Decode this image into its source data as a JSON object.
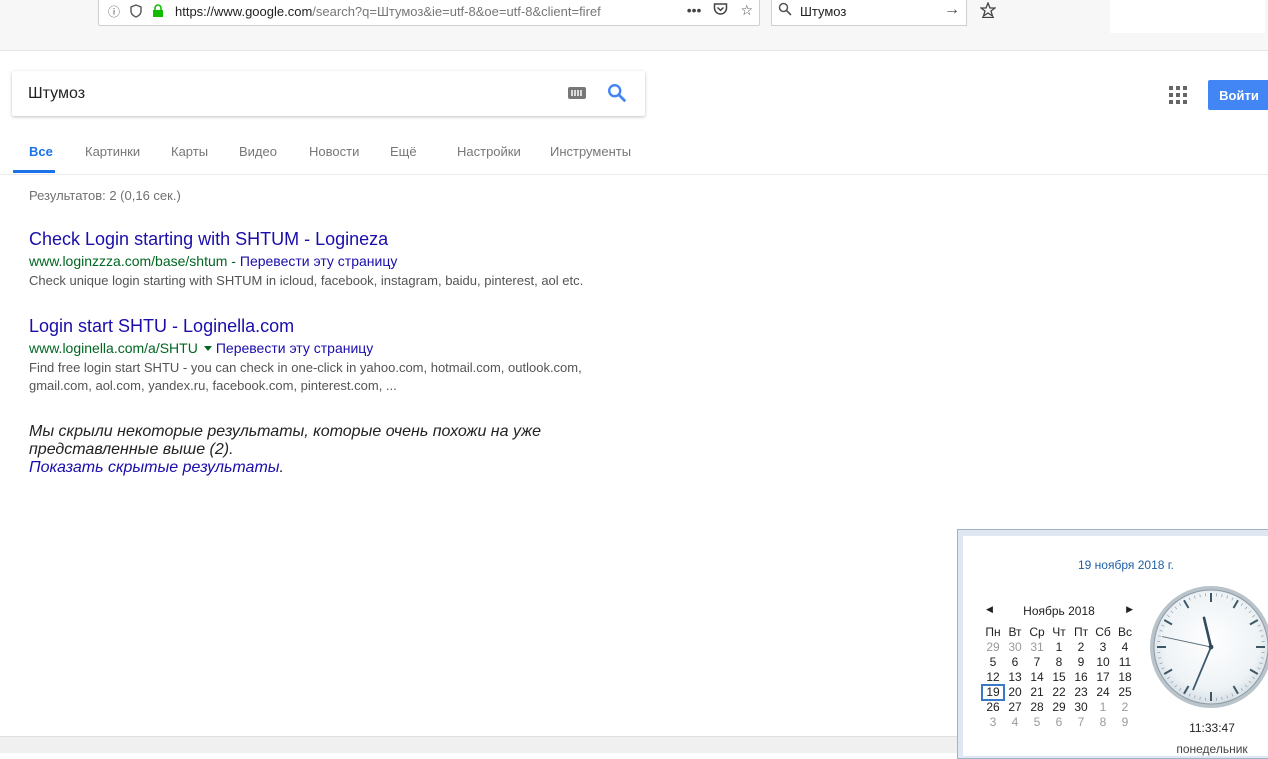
{
  "browser": {
    "url_host": "https://www.google.com",
    "url_rest": "/search?q=Штумоз&ie=utf-8&oe=utf-8&client=firef",
    "search_box_value": "Штумоз"
  },
  "google": {
    "query": "Штумоз",
    "sign_in_label": "Войти",
    "tabs": [
      "Все",
      "Картинки",
      "Карты",
      "Видео",
      "Новости",
      "Ещё",
      "Настройки",
      "Инструменты"
    ],
    "stats": "Результатов: 2 (0,16 сек.)",
    "results": [
      {
        "title": "Check Login starting with SHTUM - Logineza",
        "url": "www.loginzzza.com/base/shtum",
        "translate": "Перевести эту страницу",
        "snippet": "Check unique login starting with SHTUM in icloud, facebook, instagram, baidu, pinterest, aol etc."
      },
      {
        "title": "Login start SHTU - Loginella.com",
        "url": "www.loginella.com/a/SHTU",
        "translate": "Перевести эту страницу",
        "snippet_line1": "Find free login start SHTU - you can check in one-click in yahoo.com, hotmail.com, outlook.com,",
        "snippet_line2": "gmail.com, aol.com, yandex.ru, facebook.com, pinterest.com, ..."
      }
    ],
    "hidden_note_line1": "Мы скрыли некоторые результаты, которые очень похожи на уже",
    "hidden_note_line2": "представленные выше (2).",
    "show_hidden_link": "Показать скрытые результаты"
  },
  "flyout": {
    "date_header": "19 ноября 2018 г.",
    "month_label": "Ноябрь 2018",
    "day_names": [
      "Пн",
      "Вт",
      "Ср",
      "Чт",
      "Пт",
      "Сб",
      "Вс"
    ],
    "weeks": [
      [
        "29",
        "30",
        "31",
        "1",
        "2",
        "3",
        "4"
      ],
      [
        "5",
        "6",
        "7",
        "8",
        "9",
        "10",
        "11"
      ],
      [
        "12",
        "13",
        "14",
        "15",
        "16",
        "17",
        "18"
      ],
      [
        "19",
        "20",
        "21",
        "22",
        "23",
        "24",
        "25"
      ],
      [
        "26",
        "27",
        "28",
        "29",
        "30",
        "1",
        "2"
      ],
      [
        "3",
        "4",
        "5",
        "6",
        "7",
        "8",
        "9"
      ]
    ],
    "today": "19",
    "time": "11:33:47",
    "weekday": "понедельник",
    "clock": {
      "hours": 11,
      "minutes": 33,
      "seconds": 47
    }
  }
}
